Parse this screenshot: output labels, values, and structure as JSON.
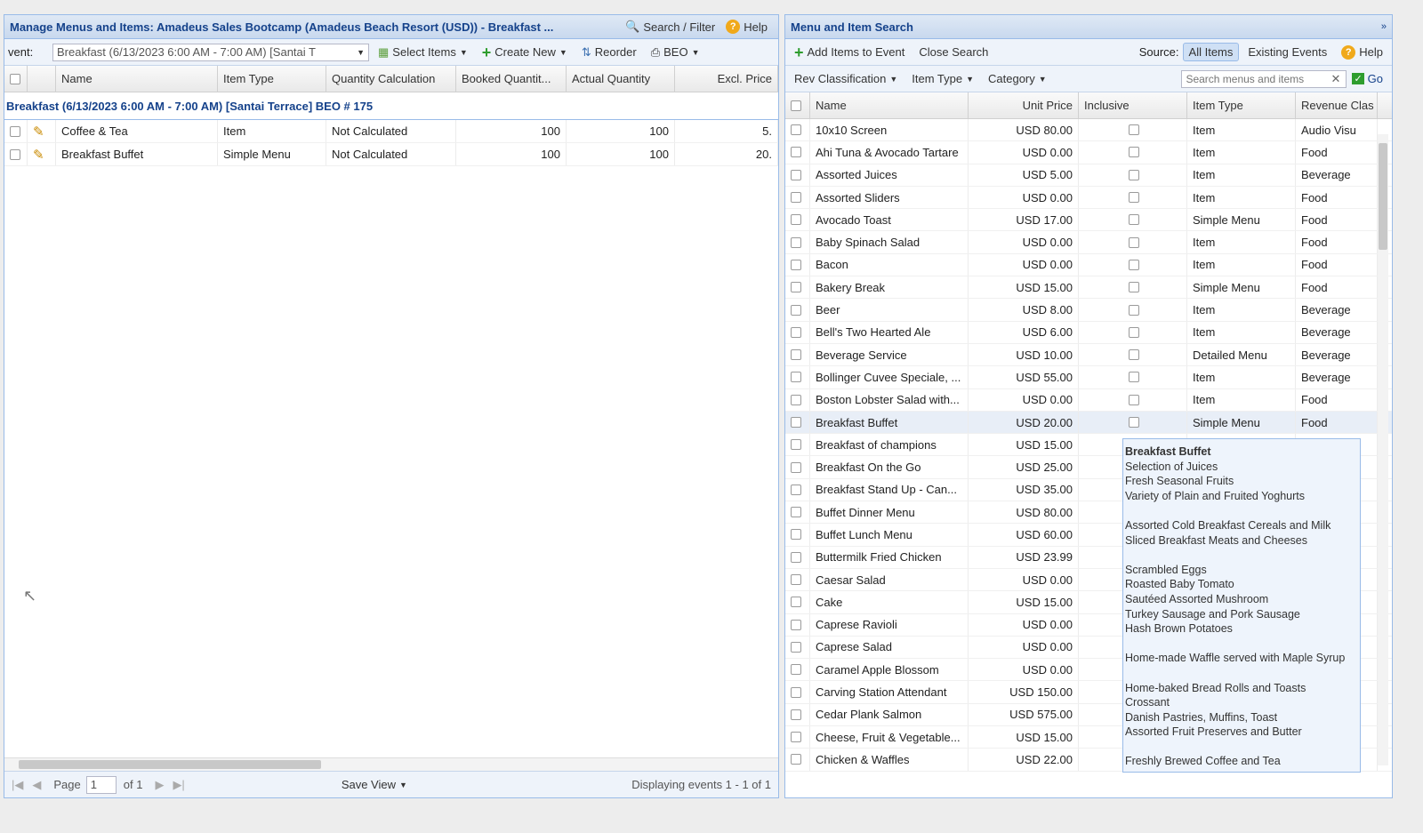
{
  "left": {
    "title": "Manage Menus and Items: Amadeus Sales Bootcamp (Amadeus Beach Resort (USD)) - Breakfast ...",
    "search_filter_label": "Search / Filter",
    "help_label": "Help",
    "event_label": "vent:",
    "event_value": "Breakfast (6/13/2023 6:00 AM - 7:00 AM) [Santai T",
    "toolbar": {
      "select_items": "Select Items",
      "create_new": "Create New",
      "reorder": "Reorder",
      "beo": "BEO"
    },
    "columns": [
      "Name",
      "Item Type",
      "Quantity Calculation",
      "Booked Quantit...",
      "Actual Quantity",
      "Excl. Price"
    ],
    "group_label": "Breakfast (6/13/2023 6:00 AM - 7:00 AM) [Santai Terrace] BEO # 175",
    "rows": [
      {
        "name": "Coffee & Tea",
        "type": "Item",
        "calc": "Not Calculated",
        "booked": "100",
        "actual": "100",
        "price": "5."
      },
      {
        "name": "Breakfast Buffet",
        "type": "Simple Menu",
        "calc": "Not Calculated",
        "booked": "100",
        "actual": "100",
        "price": "20."
      }
    ],
    "pager": {
      "page_label": "Page",
      "page_value": "1",
      "of_label": "of 1",
      "save_view": "Save View",
      "displaying": "Displaying events 1 - 1 of 1"
    }
  },
  "right": {
    "title": "Menu and Item Search",
    "toolbar": {
      "add_items": "Add Items to Event",
      "close_search": "Close Search",
      "source_label": "Source:",
      "all_items": "All Items",
      "existing_events": "Existing Events",
      "help": "Help"
    },
    "filters": {
      "rev_class": "Rev Classification",
      "item_type": "Item Type",
      "category": "Category",
      "search_placeholder": "Search menus and items",
      "go": "Go"
    },
    "columns": [
      "Name",
      "Unit Price",
      "Inclusive",
      "Item Type",
      "Revenue Clas"
    ],
    "rows": [
      {
        "name": "10x10 Screen",
        "price": "USD 80.00",
        "type": "Item",
        "rev": "Audio Visu"
      },
      {
        "name": "Ahi Tuna & Avocado Tartare",
        "price": "USD 0.00",
        "type": "Item",
        "rev": "Food"
      },
      {
        "name": "Assorted Juices",
        "price": "USD 5.00",
        "type": "Item",
        "rev": "Beverage"
      },
      {
        "name": "Assorted Sliders",
        "price": "USD 0.00",
        "type": "Item",
        "rev": "Food"
      },
      {
        "name": "Avocado Toast",
        "price": "USD 17.00",
        "type": "Simple Menu",
        "rev": "Food"
      },
      {
        "name": "Baby Spinach Salad",
        "price": "USD 0.00",
        "type": "Item",
        "rev": "Food"
      },
      {
        "name": "Bacon",
        "price": "USD 0.00",
        "type": "Item",
        "rev": "Food"
      },
      {
        "name": "Bakery Break",
        "price": "USD 15.00",
        "type": "Simple Menu",
        "rev": "Food"
      },
      {
        "name": "Beer",
        "price": "USD 8.00",
        "type": "Item",
        "rev": "Beverage"
      },
      {
        "name": "Bell's Two Hearted Ale",
        "price": "USD 6.00",
        "type": "Item",
        "rev": "Beverage"
      },
      {
        "name": "Beverage Service",
        "price": "USD 10.00",
        "type": "Detailed Menu",
        "rev": "Beverage"
      },
      {
        "name": "Bollinger Cuvee Speciale, ...",
        "price": "USD 55.00",
        "type": "Item",
        "rev": "Beverage"
      },
      {
        "name": "Boston Lobster Salad with...",
        "price": "USD 0.00",
        "type": "Item",
        "rev": "Food"
      },
      {
        "name": "Breakfast Buffet",
        "price": "USD 20.00",
        "type": "Simple Menu",
        "rev": "Food"
      },
      {
        "name": "Breakfast of champions",
        "price": "USD 15.00",
        "type": "",
        "rev": ""
      },
      {
        "name": "Breakfast On the Go",
        "price": "USD 25.00",
        "type": "",
        "rev": ""
      },
      {
        "name": "Breakfast Stand Up - Can...",
        "price": "USD 35.00",
        "type": "",
        "rev": ""
      },
      {
        "name": "Buffet Dinner Menu",
        "price": "USD 80.00",
        "type": "",
        "rev": ""
      },
      {
        "name": "Buffet Lunch Menu",
        "price": "USD 60.00",
        "type": "",
        "rev": ""
      },
      {
        "name": "Buttermilk Fried Chicken",
        "price": "USD 23.99",
        "type": "",
        "rev": ""
      },
      {
        "name": "Caesar Salad",
        "price": "USD 0.00",
        "type": "",
        "rev": ""
      },
      {
        "name": "Cake",
        "price": "USD 15.00",
        "type": "",
        "rev": ""
      },
      {
        "name": "Caprese Ravioli",
        "price": "USD 0.00",
        "type": "",
        "rev": ""
      },
      {
        "name": "Caprese Salad",
        "price": "USD 0.00",
        "type": "",
        "rev": ""
      },
      {
        "name": "Caramel Apple Blossom",
        "price": "USD 0.00",
        "type": "",
        "rev": ""
      },
      {
        "name": "Carving Station Attendant",
        "price": "USD 150.00",
        "type": "",
        "rev": ""
      },
      {
        "name": "Cedar Plank Salmon",
        "price": "USD 575.00",
        "type": "",
        "rev": ""
      },
      {
        "name": "Cheese, Fruit & Vegetable...",
        "price": "USD 15.00",
        "type": "",
        "rev": ""
      },
      {
        "name": "Chicken & Waffles",
        "price": "USD 22.00",
        "type": "",
        "rev": ""
      }
    ]
  },
  "tooltip": {
    "title": "Breakfast Buffet",
    "lines": [
      "Selection of Juices",
      "Fresh Seasonal Fruits",
      "Variety of Plain and Fruited Yoghurts",
      "",
      "Assorted Cold Breakfast Cereals and Milk",
      "Sliced Breakfast Meats and Cheeses",
      "",
      "Scrambled Eggs",
      "Roasted Baby Tomato",
      "Sautéed Assorted Mushroom",
      "Turkey Sausage and Pork Sausage",
      "Hash Brown Potatoes",
      "",
      "Home-made Waffle served with Maple Syrup",
      "",
      "Home-baked Bread Rolls and Toasts",
      "Crossant",
      "Danish Pastries, Muffins, Toast",
      "Assorted Fruit Preserves and Butter",
      "",
      "Freshly Brewed Coffee and Tea"
    ]
  },
  "colors": {
    "accent": "#15428b",
    "border": "#99bbe8",
    "add_green": "#2e9d2e",
    "help_orange": "#f0a91b"
  }
}
